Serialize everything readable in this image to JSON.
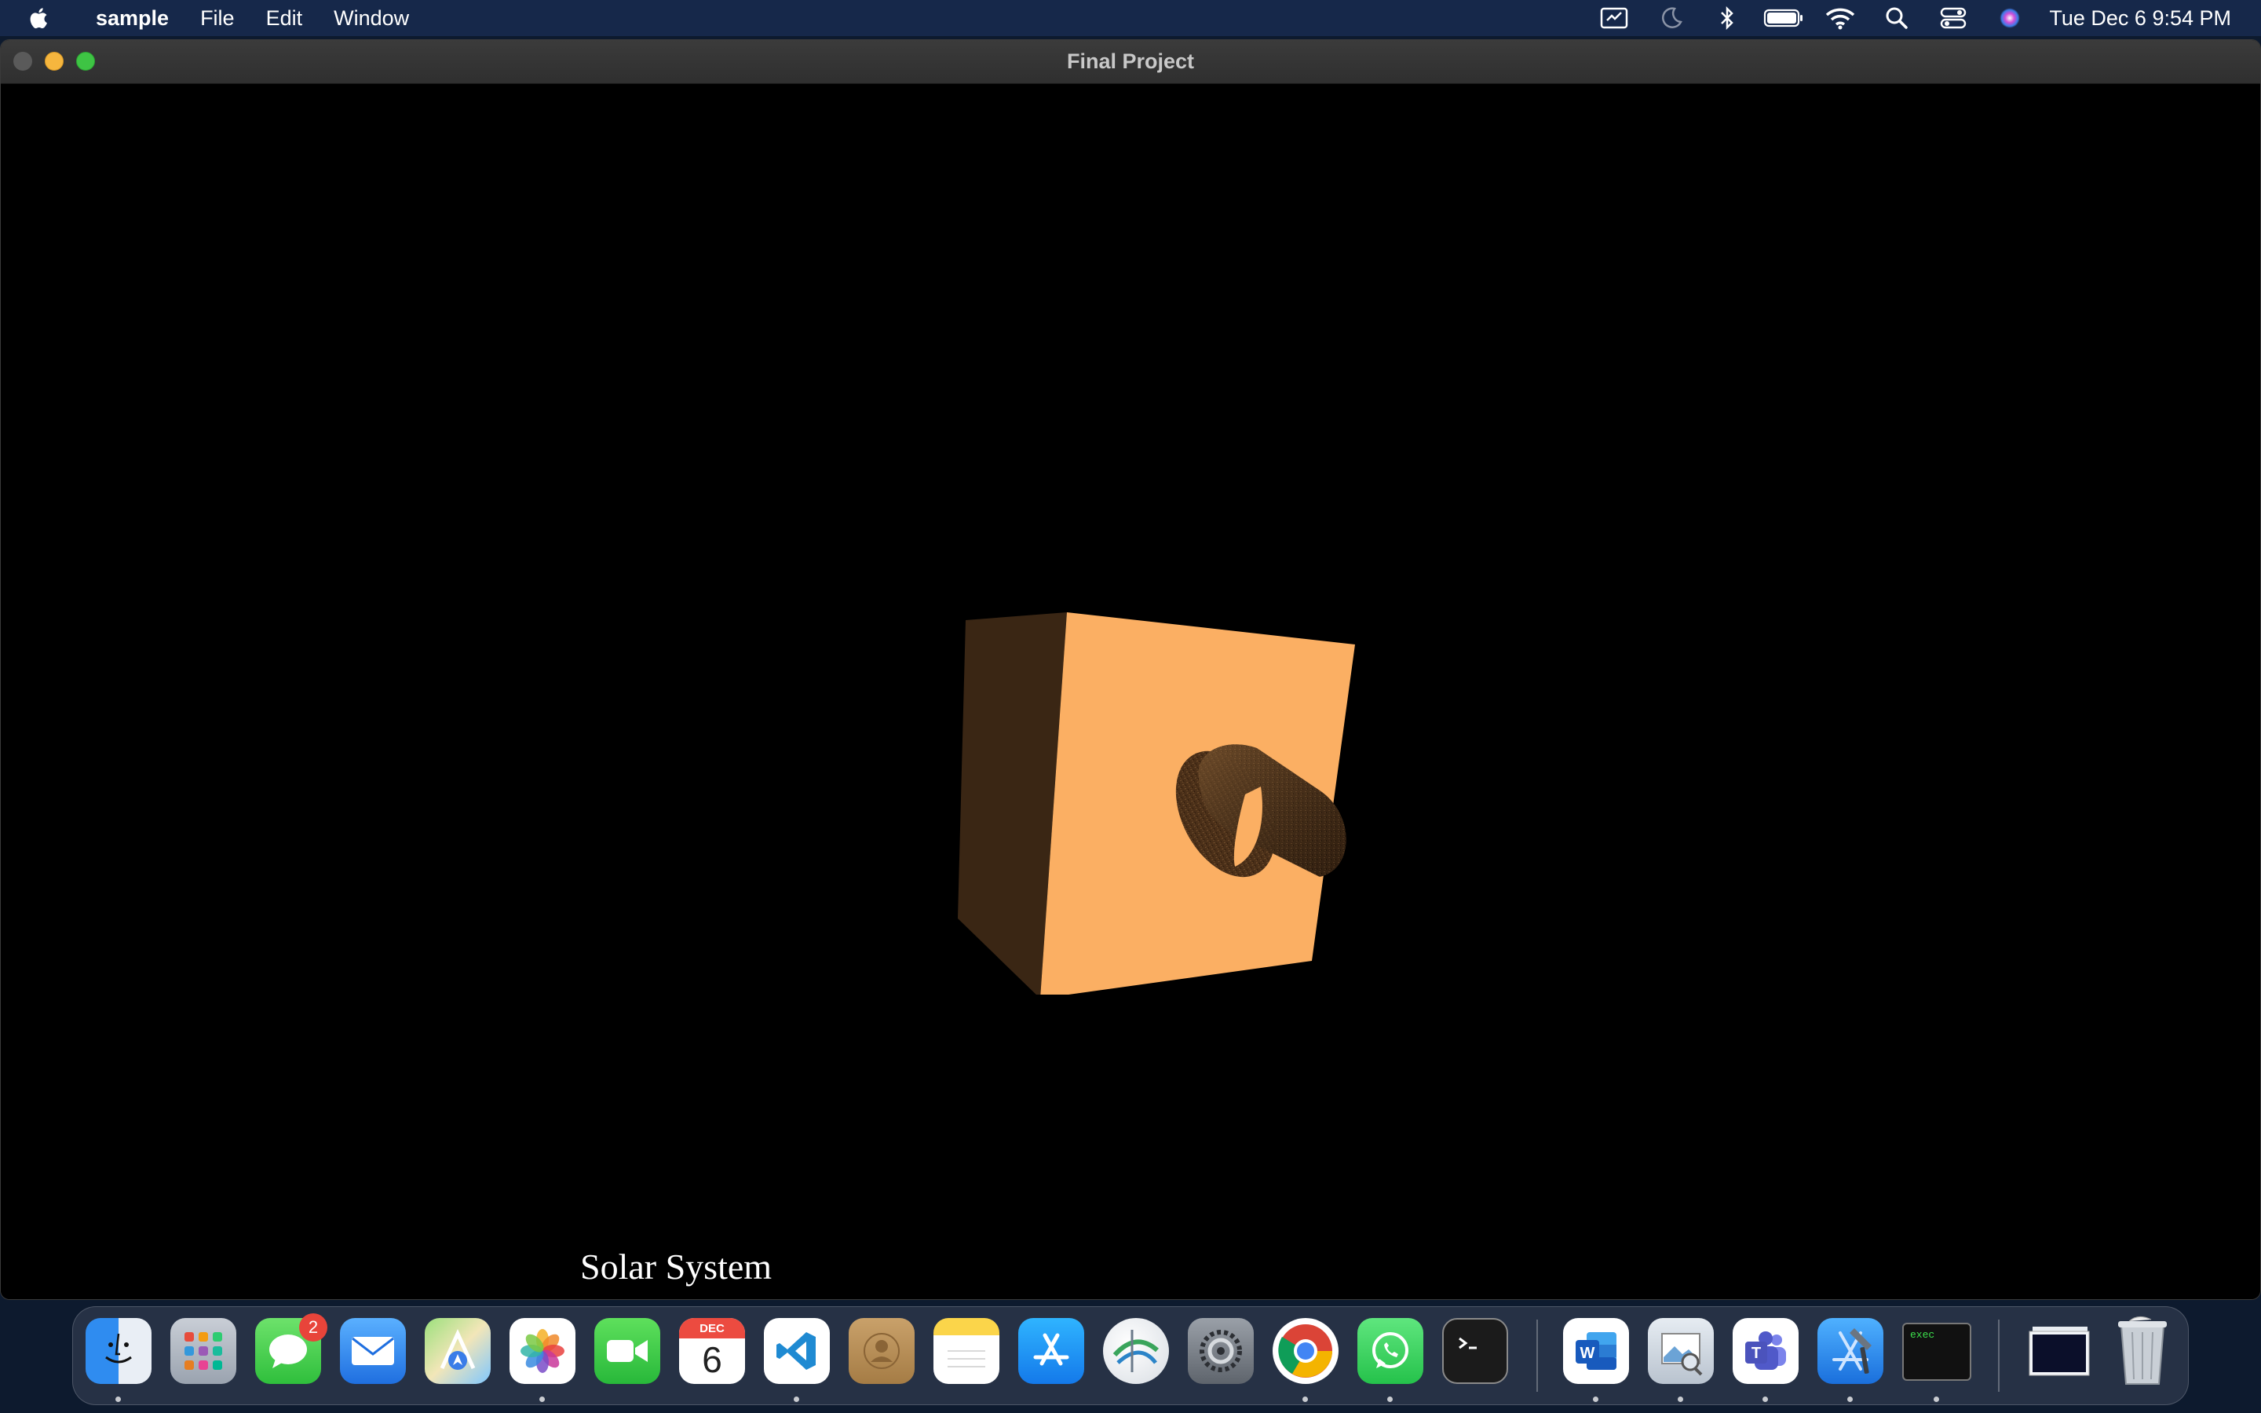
{
  "menubar": {
    "app_name": "sample",
    "menus": [
      "File",
      "Edit",
      "Window"
    ],
    "clock": "Tue Dec 6  9:54 PM",
    "status_icons": [
      "screen-mirroring-icon",
      "focus-moon-icon",
      "bluetooth-icon",
      "battery-icon",
      "wifi-icon",
      "spotlight-search-icon",
      "control-center-icon",
      "siri-icon"
    ]
  },
  "window": {
    "title": "Final Project",
    "caption": "Solar System",
    "colors": {
      "cube_front": "#FBAF63",
      "cube_side": "#3A2614",
      "cylinder": "#4A2F18"
    }
  },
  "dock": {
    "messages_badge": "2",
    "calendar_month": "DEC",
    "calendar_day": "6",
    "exec_label": "exec",
    "apps": [
      "finder",
      "launchpad",
      "messages",
      "mail",
      "maps",
      "photos",
      "facetime",
      "calendar",
      "visual-studio-code",
      "contacts",
      "notes",
      "app-store",
      "network-utility",
      "system-preferences",
      "chrome",
      "whatsapp",
      "terminal",
      "word",
      "preview",
      "teams",
      "xcode",
      "exec-terminal",
      "downloads-stack",
      "trash"
    ]
  }
}
